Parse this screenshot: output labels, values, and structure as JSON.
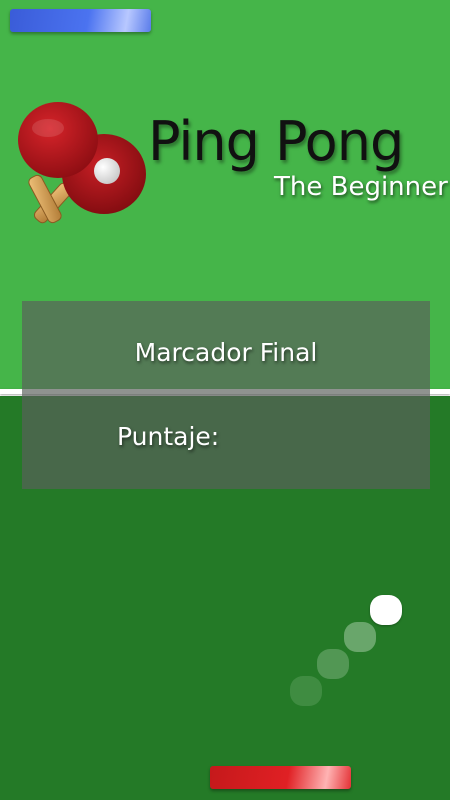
{
  "game": {
    "title": "Ping Pong",
    "subtitle": "The Beginner",
    "logo_icon": "ping-pong-paddles-icon"
  },
  "score_panel": {
    "heading": "Marcador Final",
    "score_label": "Puntaje:"
  },
  "colors": {
    "table_top": "#45b549",
    "table_bottom": "#247a27",
    "net": "#ffffff",
    "top_paddle": "#4b73f0",
    "bottom_paddle": "#e02024",
    "ball": "#ffffff"
  }
}
